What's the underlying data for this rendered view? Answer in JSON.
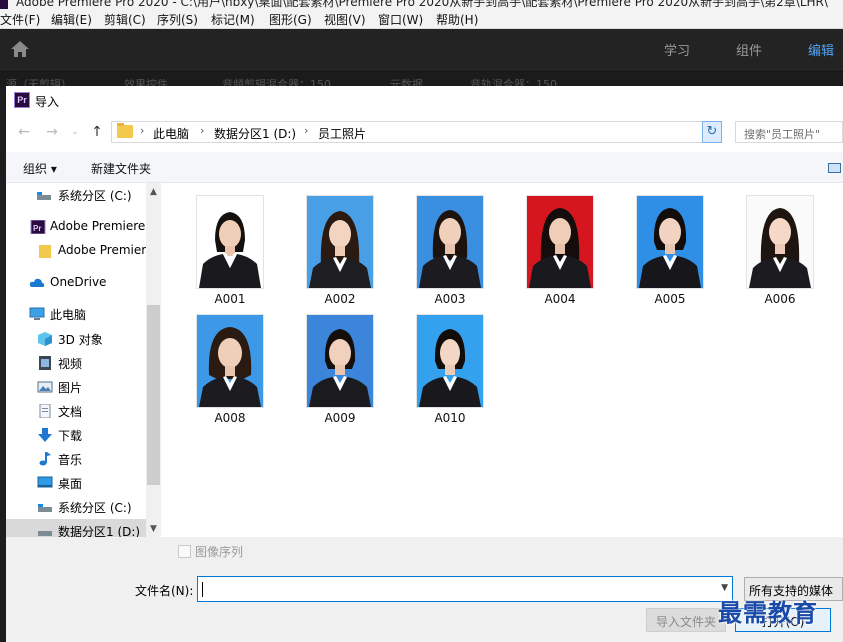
{
  "app": {
    "title": "Adobe Premiere Pro 2020 - C:\\用户\\hbxy\\桌面\\配套素材\\Premiere Pro 2020从新手到高手\\配套素材\\Premiere Pro 2020从新手到高手\\第2章\\LHR\\",
    "menu": [
      "文件(F)",
      "编辑(E)",
      "剪辑(C)",
      "序列(S)",
      "标记(M)",
      "图形(G)",
      "视图(V)",
      "窗口(W)",
      "帮助(H)"
    ],
    "workspaces": [
      "学习",
      "组件",
      "编辑"
    ],
    "active_workspace": "编辑",
    "panel_tabs_partial": [
      "源（无剪辑）",
      "效果控件",
      "音频剪辑混合器：150",
      "元数据",
      "音轨混合器：150"
    ]
  },
  "dialog": {
    "title": "导入",
    "breadcrumb": [
      "此电脑",
      "数据分区1 (D:)",
      "员工照片"
    ],
    "search_placeholder": "搜索\"员工照片\"",
    "toolbar": {
      "organize": "组织 ▾",
      "new_folder": "新建文件夹"
    },
    "sidebar": [
      {
        "label": "系统分区 (C:)",
        "icon": "drive-icon",
        "indent": true
      },
      {
        "label": "Adobe Premiere",
        "icon": "premiere-icon",
        "indent": false
      },
      {
        "label": "Adobe Premier",
        "icon": "folder-icon",
        "indent": true
      },
      {
        "label": "OneDrive",
        "icon": "cloud-icon",
        "indent": false
      },
      {
        "label": "此电脑",
        "icon": "computer-icon",
        "indent": false
      },
      {
        "label": "3D 对象",
        "icon": "cube-icon",
        "indent": true
      },
      {
        "label": "视频",
        "icon": "video-icon",
        "indent": true
      },
      {
        "label": "图片",
        "icon": "picture-icon",
        "indent": true
      },
      {
        "label": "文档",
        "icon": "document-icon",
        "indent": true
      },
      {
        "label": "下载",
        "icon": "download-icon",
        "indent": true
      },
      {
        "label": "音乐",
        "icon": "music-icon",
        "indent": true
      },
      {
        "label": "桌面",
        "icon": "desktop-icon",
        "indent": true
      },
      {
        "label": "系统分区 (C:)",
        "icon": "drive-icon",
        "indent": true
      },
      {
        "label": "数据分区1 (D:)",
        "icon": "drive-icon",
        "indent": true,
        "selected": true
      }
    ],
    "files": [
      {
        "name": "A001",
        "bg": "#ffffff"
      },
      {
        "name": "A002",
        "bg": "#4aa0e6"
      },
      {
        "name": "A003",
        "bg": "#3a8fe0"
      },
      {
        "name": "A004",
        "bg": "#d6161f"
      },
      {
        "name": "A005",
        "bg": "#2f8ee6"
      },
      {
        "name": "A006",
        "bg": "#fafafa"
      },
      {
        "name": "A008",
        "bg": "#3d99e8"
      },
      {
        "name": "A009",
        "bg": "#3b86da"
      },
      {
        "name": "A010",
        "bg": "#33a1ee"
      }
    ],
    "image_sequence_label": "图像序列",
    "image_sequence_checked": false,
    "filename_label": "文件名(N):",
    "filename_value": "",
    "file_type": "所有支持的媒体",
    "import_folder_label": "导入文件夹",
    "open_label": "打开(O)"
  },
  "watermark": "最需教育",
  "colors": {
    "accent": "#0078d7",
    "workspace_active": "#4ea3f5",
    "premiere_purple": "#2a0b3d"
  }
}
